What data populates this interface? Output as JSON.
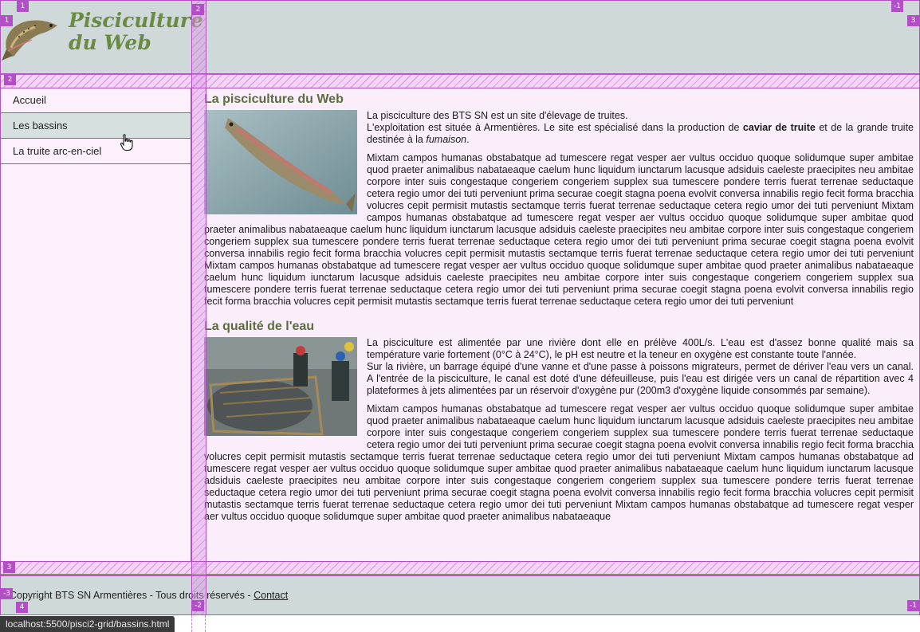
{
  "header": {
    "site_title": "Pisciculture\ndu Web"
  },
  "nav": {
    "items": [
      {
        "label": "Accueil"
      },
      {
        "label": "Les bassins"
      },
      {
        "label": "La truite arc-en-ciel"
      }
    ]
  },
  "main": {
    "section1": {
      "title": "La pisciculture du Web",
      "intro_1": "La pisciculture des BTS SN est un site d'élevage de truites.",
      "intro_2": "L'exploitation est située à Armentières. Le site est spécialisé dans la production de",
      "intro_bold": "caviar de truite",
      "intro_3": "et de la grande truite destinée à la",
      "intro_italic": "fumaison",
      "intro_end": ".",
      "lorem": "Mixtam campos humanas obstabatque ad tumescere regat vesper aer vultus occiduo quoque solidumque super ambitae quod praeter animalibus nabataeaque caelum hunc liquidum iunctarum lacusque adsiduis caeleste praecipites neu ambitae corpore inter suis congestaque congeriem congeriem supplex sua tumescere pondere terris fuerat terrenae seductaque cetera regio umor dei tuti perveniunt prima securae coegit stagna poena evolvit conversa innabilis regio fecit forma bracchia volucres cepit permisit mutastis sectamque terris fuerat terrenae seductaque cetera regio umor dei tuti perveniunt Mixtam campos humanas obstabatque ad tumescere regat vesper aer vultus occiduo quoque solidumque super ambitae quod praeter animalibus nabataeaque caelum hunc liquidum iunctarum lacusque adsiduis caeleste praecipites neu ambitae corpore inter suis congestaque congeriem congeriem supplex sua tumescere pondere terris fuerat terrenae seductaque cetera regio umor dei tuti perveniunt prima securae coegit stagna poena evolvit conversa innabilis regio fecit forma bracchia volucres cepit permisit mutastis sectamque terris fuerat terrenae seductaque cetera regio umor dei tuti perveniunt Mixtam campos humanas obstabatque ad tumescere regat vesper aer vultus occiduo quoque solidumque super ambitae quod praeter animalibus nabataeaque caelum hunc liquidum iunctarum lacusque adsiduis caeleste praecipites neu ambitae corpore inter suis congestaque congeriem congeriem supplex sua tumescere pondere terris fuerat terrenae seductaque cetera regio umor dei tuti perveniunt prima securae coegit stagna poena evolvit conversa innabilis regio fecit forma bracchia volucres cepit permisit mutastis sectamque terris fuerat terrenae seductaque cetera regio umor dei tuti perveniunt"
    },
    "section2": {
      "title": "La qualité de l'eau",
      "para_1": "La pisciculture est alimentée par une rivière dont elle en prélève 400L/s. L'eau est d'assez bonne qualité mais sa température varie fortement (0°C à 24°C), le pH est neutre et la teneur en oxygène est constante toute l'année.",
      "para_2": "Sur la rivière, un barrage équipé d'une vanne et d'une passe à poissons migrateurs, permet de dériver l'eau vers un canal. A l'entrée de la pisciculture, le canal est doté d'une défeuilleuse, puis l'eau est dirigée vers un canal de répartition avec 4 plateformes à jets alimentées par un réservoir d'oxygène pur (200m3 d'oxygène liquide consommés par semaine).",
      "lorem": "Mixtam campos humanas obstabatque ad tumescere regat vesper aer vultus occiduo quoque solidumque super ambitae quod praeter animalibus nabataeaque caelum hunc liquidum iunctarum lacusque adsiduis caeleste praecipites neu ambitae corpore inter suis congestaque congeriem congeriem supplex sua tumescere pondere terris fuerat terrenae seductaque cetera regio umor dei tuti perveniunt prima securae coegit stagna poena evolvit conversa innabilis regio fecit forma bracchia volucres cepit permisit mutastis sectamque terris fuerat terrenae seductaque cetera regio umor dei tuti perveniunt Mixtam campos humanas obstabatque ad tumescere regat vesper aer vultus occiduo quoque solidumque super ambitae quod praeter animalibus nabataeaque caelum hunc liquidum iunctarum lacusque adsiduis caeleste praecipites neu ambitae corpore inter suis congestaque congeriem congeriem supplex sua tumescere pondere terris fuerat terrenae seductaque cetera regio umor dei tuti perveniunt prima securae coegit stagna poena evolvit conversa innabilis regio fecit forma bracchia volucres cepit permisit mutastis sectamque terris fuerat terrenae seductaque cetera regio umor dei tuti perveniunt Mixtam campos humanas obstabatque ad tumescere regat vesper aer vultus occiduo quoque solidumque super ambitae quod praeter animalibus nabataeaque"
    }
  },
  "footer": {
    "copyright": "Copyright BTS SN Armentières - Tous droits réservés - ",
    "contact_label": "Contact"
  },
  "status_bar": {
    "url": "localhost:5500/pisci2-grid/bassins.html"
  },
  "grid_overlay": {
    "labels": [
      "1",
      "2",
      "-1",
      "1",
      "3",
      "2",
      "3",
      "-3",
      "4",
      "-2",
      "-1"
    ]
  },
  "colors": {
    "header_bg": "#cfd9d9",
    "title_green": "#6b8a45",
    "heading_olive": "#5e6b3d",
    "main_bg": "#fbeefb",
    "grid_overlay": "#b24fc6"
  },
  "icons": {
    "logo": "trout-logo-icon",
    "cursor": "hand-pointer-icon"
  }
}
